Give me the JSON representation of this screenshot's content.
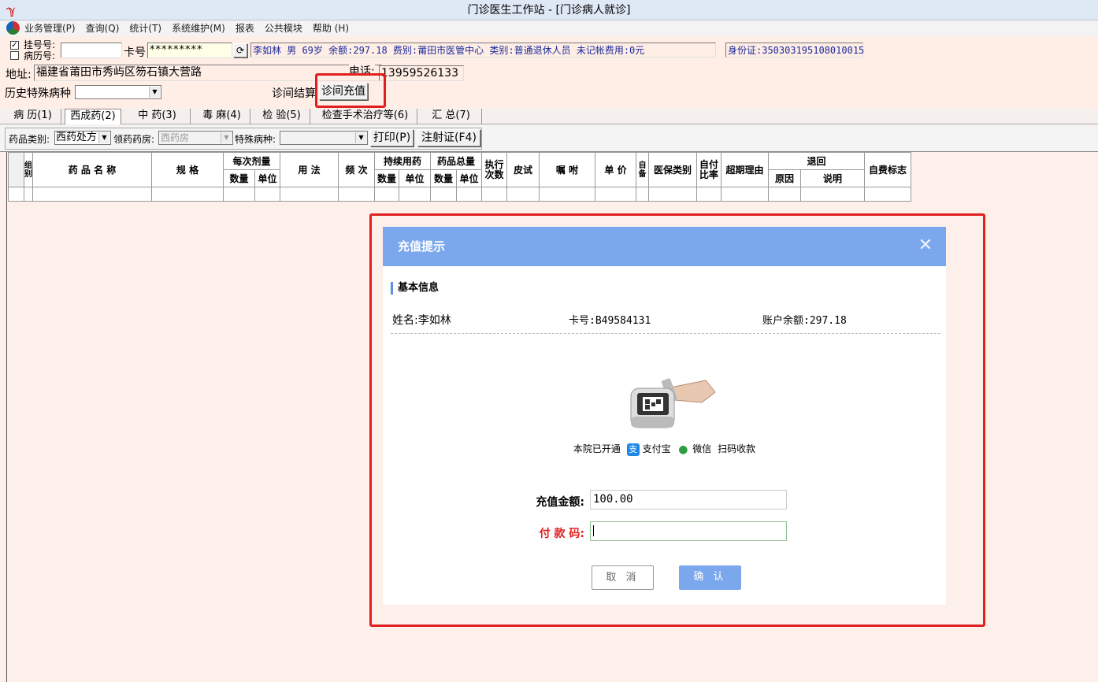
{
  "window": {
    "title": "门诊医生工作站 - [门诊病人就诊]"
  },
  "menu": [
    "业务管理(P)",
    "查询(Q)",
    "统计(T)",
    "系统维护(M)",
    "报表",
    "公共模块",
    "帮助 (H)"
  ],
  "patient": {
    "reg_label": "挂号号:",
    "record_label": "病历号:",
    "card_label": "卡号",
    "card_value": "*********",
    "info_text": "李如林 男 69岁 余额:297.18 费别:莆田市医管中心 类别:普通退休人员 未记帐费用:0元",
    "id_text": "身份证:350303195108010015",
    "address_label": "地址:",
    "address_value": "福建省莆田市秀屿区笏石镇大营路",
    "phone_label": "电话:",
    "phone_value": "13959526133",
    "history_label": "历史特殊病种",
    "settle_button": "诊间结算",
    "recharge_button": "诊间充值"
  },
  "tabs": [
    "病 历(1)",
    "西成药(2)",
    "中 药(3)",
    "毒 麻(4)",
    "检 验(5)",
    "检查手术治疗等(6)",
    "汇 总(7)"
  ],
  "drugbar": {
    "category_label": "药品类别:",
    "category_value": "西药处方",
    "pharmacy_label": "领药药房:",
    "pharmacy_value": "西药房",
    "special_label": "特殊病种:",
    "print_button": "打印(P)",
    "injection_button": "注射证(F4)"
  },
  "table": {
    "group": "组别",
    "name": "药 品 名 称",
    "spec": "规 格",
    "dose": "每次剂量",
    "usage": "用 法",
    "freq": "频 次",
    "continuous": "持续用药",
    "total": "药品总量",
    "exec": "执行次数",
    "skin": "皮试",
    "instruct": "嘱 咐",
    "price": "单 价",
    "self": "自备",
    "insurance": "医保类别",
    "selfpay": "自付比率",
    "overdue": "超期理由",
    "return": "退回",
    "selffee": "自费标志",
    "qty": "数量",
    "unit": "单位",
    "reason": "原因",
    "note": "说明"
  },
  "modal": {
    "title": "充值提示",
    "section": "基本信息",
    "name_text": "姓名:李如林",
    "card_text": "卡号:B49584131",
    "balance_text": "账户余额:297.18",
    "pay_prefix": "本院已开通",
    "alipay": "支付宝",
    "wechat": "微信",
    "pay_suffix": "扫码收款",
    "amount_label": "充值金额:",
    "amount_value": "100.00",
    "paycode_label": "付 款 码:",
    "cancel": "取 消",
    "confirm": "确 认"
  },
  "colors": {
    "accent": "#7ba7ec",
    "highlight": "#e02020",
    "background": "#fdf0ea"
  }
}
